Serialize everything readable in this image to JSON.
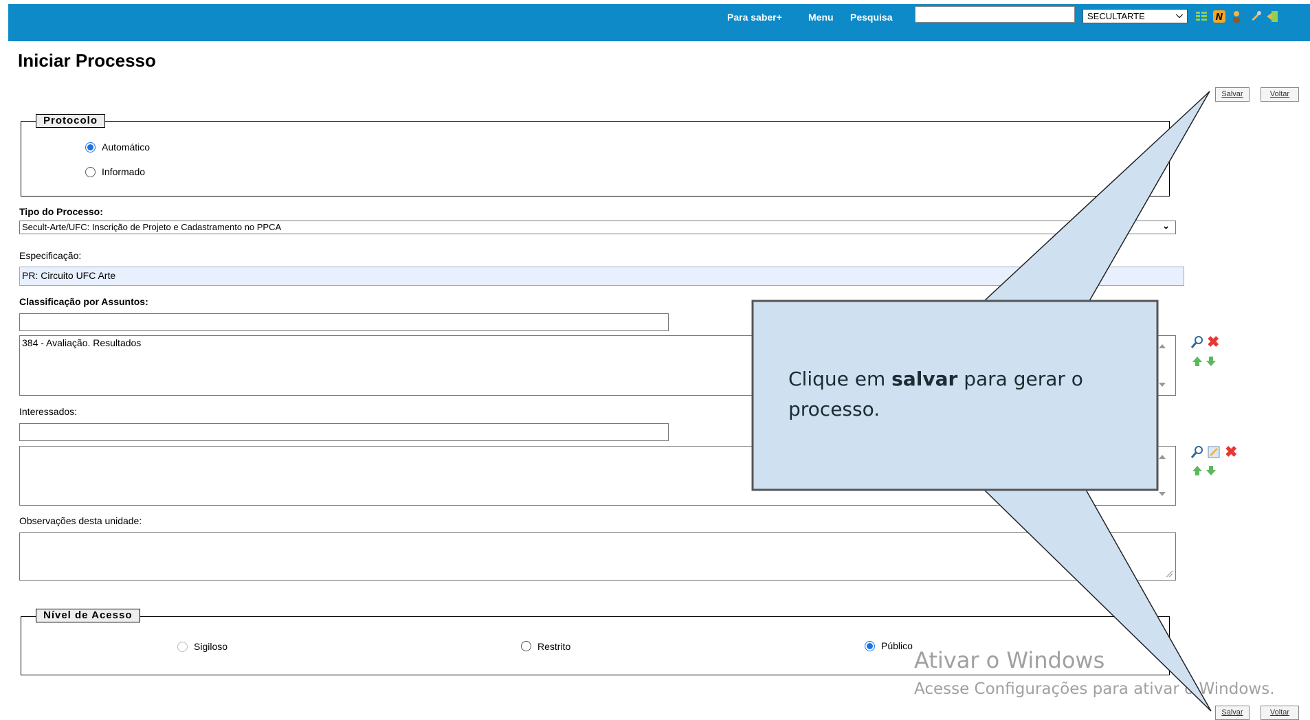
{
  "topbar": {
    "links": [
      "Para saber+",
      "Menu",
      "Pesquisa"
    ],
    "search_value": "",
    "unit_select": "SECULTARTE",
    "icons": [
      "list-icon",
      "n-icon",
      "user-icon",
      "tools-icon",
      "exit-icon"
    ],
    "color": "#0d8ac7"
  },
  "page": {
    "title": "Iniciar Processo"
  },
  "buttons": {
    "save": "Salvar",
    "back": "Voltar"
  },
  "protocolo": {
    "legend": "Protocolo",
    "options": [
      {
        "label": "Automático",
        "checked": true
      },
      {
        "label": "Informado",
        "checked": false
      }
    ]
  },
  "tipo_processo": {
    "label": "Tipo do Processo:",
    "value": "Secult-Arte/UFC: Inscrição de Projeto e Cadastramento no PPCA"
  },
  "especificacao": {
    "label": "Especificação:",
    "value": "PR: Circuito UFC Arte"
  },
  "classificacao": {
    "label": "Classificação por Assuntos:",
    "input_value": "",
    "items": [
      "384 - Avaliação. Resultados"
    ]
  },
  "interessados": {
    "label": "Interessados:",
    "input_value": "",
    "items": []
  },
  "observacoes": {
    "label": "Observações desta unidade:",
    "value": ""
  },
  "nivel_acesso": {
    "legend": "Nível de Acesso",
    "options": [
      {
        "label": "Sigiloso",
        "checked": false,
        "disabled": true
      },
      {
        "label": "Restrito",
        "checked": false,
        "disabled": false
      },
      {
        "label": "Público",
        "checked": true,
        "disabled": false
      }
    ]
  },
  "callout": {
    "text_before": "Clique em ",
    "text_bold": "salvar",
    "text_after": " para gerar o processo.",
    "fill": "#cfe0f1"
  },
  "watermark": {
    "title": "Ativar o Windows",
    "subtitle": "Acesse Configurações para ativar o Windows."
  }
}
